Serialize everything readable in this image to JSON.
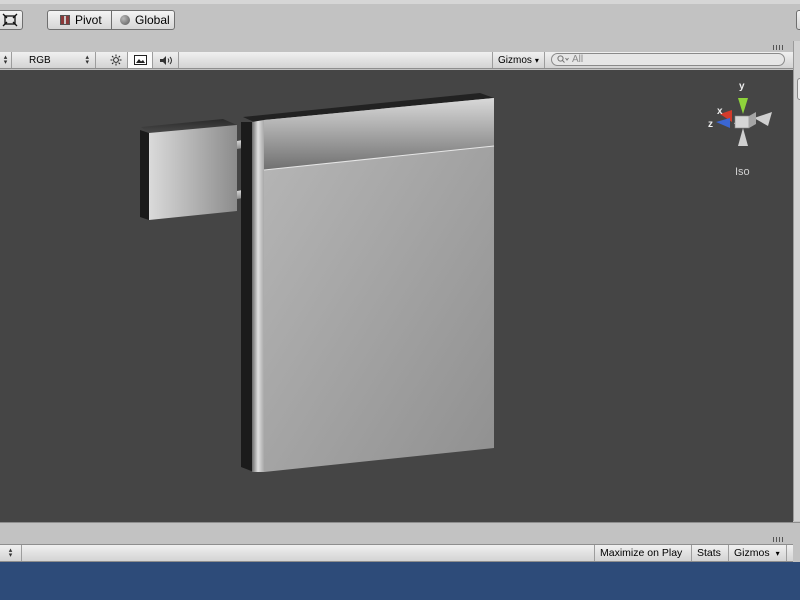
{
  "toolbar": {
    "pivot_label": "Pivot",
    "global_label": "Global"
  },
  "scene_toolbar": {
    "render_mode_value": "RGB",
    "gizmos_label": "Gizmos",
    "search_placeholder": "All",
    "gizmos_arrow": "▾"
  },
  "scene_gizmo": {
    "axis_y": "y",
    "axis_x": "x",
    "axis_z": "z",
    "projection_label": "Iso",
    "colors": {
      "x": "#d23b2b",
      "y": "#8ed33b",
      "z": "#3b66d2"
    }
  },
  "game_toolbar": {
    "maximize_label": "Maximize on Play",
    "stats_label": "Stats",
    "gizmos_label": "Gizmos",
    "gizmos_arrow": "▾"
  },
  "colors": {
    "viewport_bg": "#454545",
    "game_bg": "#2d4b79"
  },
  "icons": [
    "maximize-icon",
    "pivot-icon",
    "globe-icon",
    "lighting-icon",
    "scene-image-icon",
    "audio-icon",
    "search-icon"
  ]
}
